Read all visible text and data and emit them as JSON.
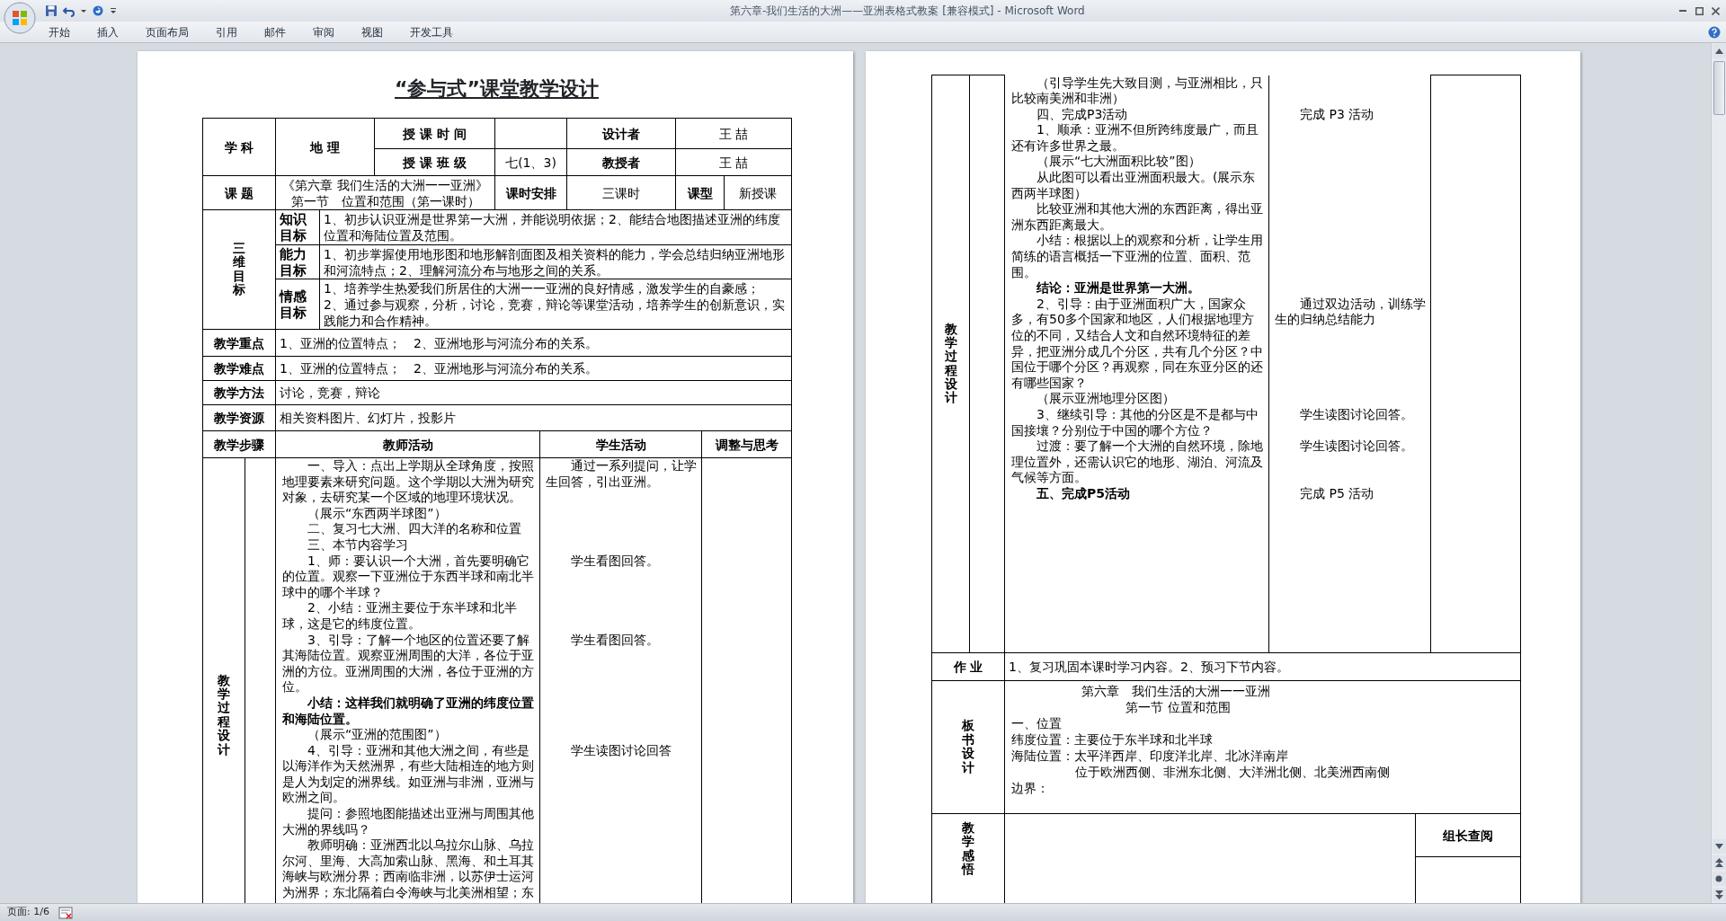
{
  "window": {
    "title": "第六章-我们生活的大洲——亚洲表格式教案 [兼容模式] - Microsoft Word"
  },
  "ribbon_tabs": [
    {
      "label": "开始",
      "selected": false
    },
    {
      "label": "插入",
      "selected": false
    },
    {
      "label": "页面布局",
      "selected": false
    },
    {
      "label": "引用",
      "selected": false
    },
    {
      "label": "邮件",
      "selected": false
    },
    {
      "label": "审阅",
      "selected": false
    },
    {
      "label": "视图",
      "selected": false
    },
    {
      "label": "开发工具",
      "selected": false
    }
  ],
  "left_page": {
    "title": "“参与式”课堂教学设计",
    "info": {
      "subject_label": "学 科",
      "subject": "地 理",
      "time_label": "授 课 时 间",
      "designer_label": "设计者",
      "designer": "王 喆",
      "class_label": "授 课 班 级",
      "class": "七(1、3)",
      "teacher_label": "教授者",
      "teacher": "王 喆",
      "topic_label": "课 题",
      "topic": [
        "《第六章 我们生活的大洲一一亚洲》",
        "第一节　位置和范围（第一课时）"
      ],
      "hours_label": "课时安排",
      "hours": "三课时",
      "type_label": "课型",
      "type": "新授课"
    },
    "goals_label": "三维目标",
    "goals": [
      {
        "label": "知识目标",
        "lines": [
          "1、初步认识亚洲是世界第一大洲，并能说明依据；2、能结合地图描述亚洲的纬度位置和海陆位置及范围。"
        ]
      },
      {
        "label": "能力目标",
        "lines": [
          "1、初步掌握使用地形图和地形解剖面图及相关资料的能力，学会总结归纳亚洲地形和河流特点；2、理解河流分布与地形之间的关系。"
        ]
      },
      {
        "label": "情感目标",
        "lines": [
          "1、培养学生热爱我们所居住的大洲一一亚洲的良好情感，激发学生的自豪感；",
          "2、通过参与观察，分析，讨论，竞赛，辩论等课堂活动，培养学生的创新意识，实践能力和合作精神。"
        ]
      }
    ],
    "rows": [
      {
        "label": "教学重点",
        "text": "1、亚洲的位置特点；　2、亚洲地形与河流分布的关系。"
      },
      {
        "label": "教学难点",
        "text": "1、亚洲的位置特点；　2、亚洲地形与河流分布的关系。"
      },
      {
        "label": "教学方法",
        "text": "讨论，竞赛，辩论"
      },
      {
        "label": "教学资源",
        "text": "相关资料图片、幻灯片，投影片"
      }
    ],
    "process_header": {
      "step": "教学步骤",
      "teacher": "教师活动",
      "student": "学生活动",
      "adjust": "调整与思考"
    },
    "process_label": "教学过程设计",
    "steps": [
      {
        "teacher": "一、导入：点出上学期从全球角度，按照地理要素来研究问题。这个学期以大洲为研究对象，去研究某一个区域的地理环境状况。",
        "student": "通过一系列提问，让学生回答，引出亚洲。",
        "bold": false
      },
      {
        "teacher": "（展示“东西两半球图”）",
        "bold": false
      },
      {
        "teacher": "二、复习七大洲、四大洋的名称和位置",
        "bold": false
      },
      {
        "teacher": "三、本节内容学习",
        "bold": false
      },
      {
        "teacher": "1、师：要认识一个大洲，首先要明确它的位置。观察一下亚洲位于东西半球和南北半球中的哪个半球？",
        "student": "学生看图回答。",
        "bold": false
      },
      {
        "teacher": "2、小结：亚洲主要位于东半球和北半球，这是它的纬度位置。",
        "bold": false
      },
      {
        "teacher": "3、引导：了解一个地区的位置还要了解其海陆位置。观察亚洲周围的大洋，各位于亚洲的方位。亚洲周围的大洲，各位于亚洲的方位。",
        "student": "学生看图回答。",
        "bold": false
      },
      {
        "teacher": "小结：这样我们就明确了亚洲的纬度位置和海陆位置。",
        "bold": true
      },
      {
        "teacher": "（展示“亚洲的范围图”）",
        "bold": false
      },
      {
        "teacher": "4、引导：亚洲和其他大洲之间，有些是以海洋作为天然洲界，有些大陆相连的地方则是人为划定的洲界线。如亚洲与非洲，亚洲与欧洲之间。",
        "student": "学生读图讨论回答",
        "bold": false
      },
      {
        "teacher": "提问：参照地图能描述出亚洲与周围其他大洲的界线吗？",
        "bold": false
      },
      {
        "teacher": "教师明确：亚洲西北以乌拉尔山脉、乌拉尔河、里海、大高加索山脉、黑海、和土耳其海峡与欧洲分界；西南临非洲，以苏伊士运河为洲界；东北隔着白令海峡与北美洲相望；东",
        "bold": false
      }
    ]
  },
  "right_page": {
    "process_label": "教学过程设计",
    "steps": [
      {
        "teacher": "（引导学生先大致目测，与亚洲相比，只比较南美洲和非洲）",
        "bold": false
      },
      {
        "teacher": "四、完成P3活动",
        "student": "完成 P3 活动",
        "bold": false
      },
      {
        "teacher": "1、顺承：亚洲不但所跨纬度最广，而且还有许多世界之最。",
        "bold": false
      },
      {
        "teacher": "（展示“七大洲面积比较”图）",
        "bold": false
      },
      {
        "teacher": "从此图可以看出亚洲面积最大。(展示东西两半球图）",
        "bold": false
      },
      {
        "teacher": "比较亚洲和其他大洲的东西距离，得出亚洲东西距离最大。",
        "bold": false
      },
      {
        "teacher": "小结：根据以上的观察和分析，让学生用简练的语言概括一下亚洲的位置、面积、范围。",
        "bold": false
      },
      {
        "teacher": "结论：亚洲是世界第一大洲。",
        "bold": true
      },
      {
        "teacher": "2、引导：由于亚洲面积广大，国家众多，有50多个国家和地区，人们根据地理方位的不同，又结合人文和自然环境特征的差异，把亚洲分成几个分区，共有几个分区？中国位于哪个分区？再观察，同在东亚分区的还有哪些国家？",
        "student": "通过双边活动，训练学生的归纳总结能力",
        "bold": false
      },
      {
        "teacher": "（展示亚洲地理分区图）",
        "bold": false
      },
      {
        "teacher": "3、继续引导：其他的分区是不是都与中国接壤？分别位于中国的哪个方位？",
        "student": "学生读图讨论回答。",
        "bold": false
      },
      {
        "teacher": "过渡：要了解一个大洲的自然环境，除地理位置外，还需认识它的地形、湖泊、河流及气候等方面。",
        "student": "学生读图讨论回答。",
        "bold": false
      },
      {
        "teacher": "五、完成P5活动",
        "student": "完成 P5 活动",
        "bold": true
      }
    ],
    "homework": {
      "label": "作 业",
      "text": "1、复习巩固本课时学习内容。2、预习下节内容。"
    },
    "board": {
      "label": "板书设计",
      "lines": [
        {
          "kind": "title",
          "text": "第六章　我们生活的大洲一一亚洲"
        },
        {
          "kind": "subtitle",
          "text": "第一节 位置和范围"
        },
        {
          "kind": "line",
          "text": "一、位置"
        },
        {
          "kind": "line",
          "text": "纬度位置：主要位于东半球和北半球"
        },
        {
          "kind": "line",
          "text": "海陆位置：太平洋西岸、印度洋北岸、北冰洋南岸"
        },
        {
          "kind": "indented",
          "text": "位于欧洲西侧、非洲东北侧、大洋洲北侧、北美洲西南侧"
        },
        {
          "kind": "line",
          "text": "边界："
        }
      ]
    },
    "reflection": {
      "label": "教学感悟",
      "review_label": "组长查阅"
    }
  },
  "status_bar": {
    "page": "页面: 1/6"
  }
}
